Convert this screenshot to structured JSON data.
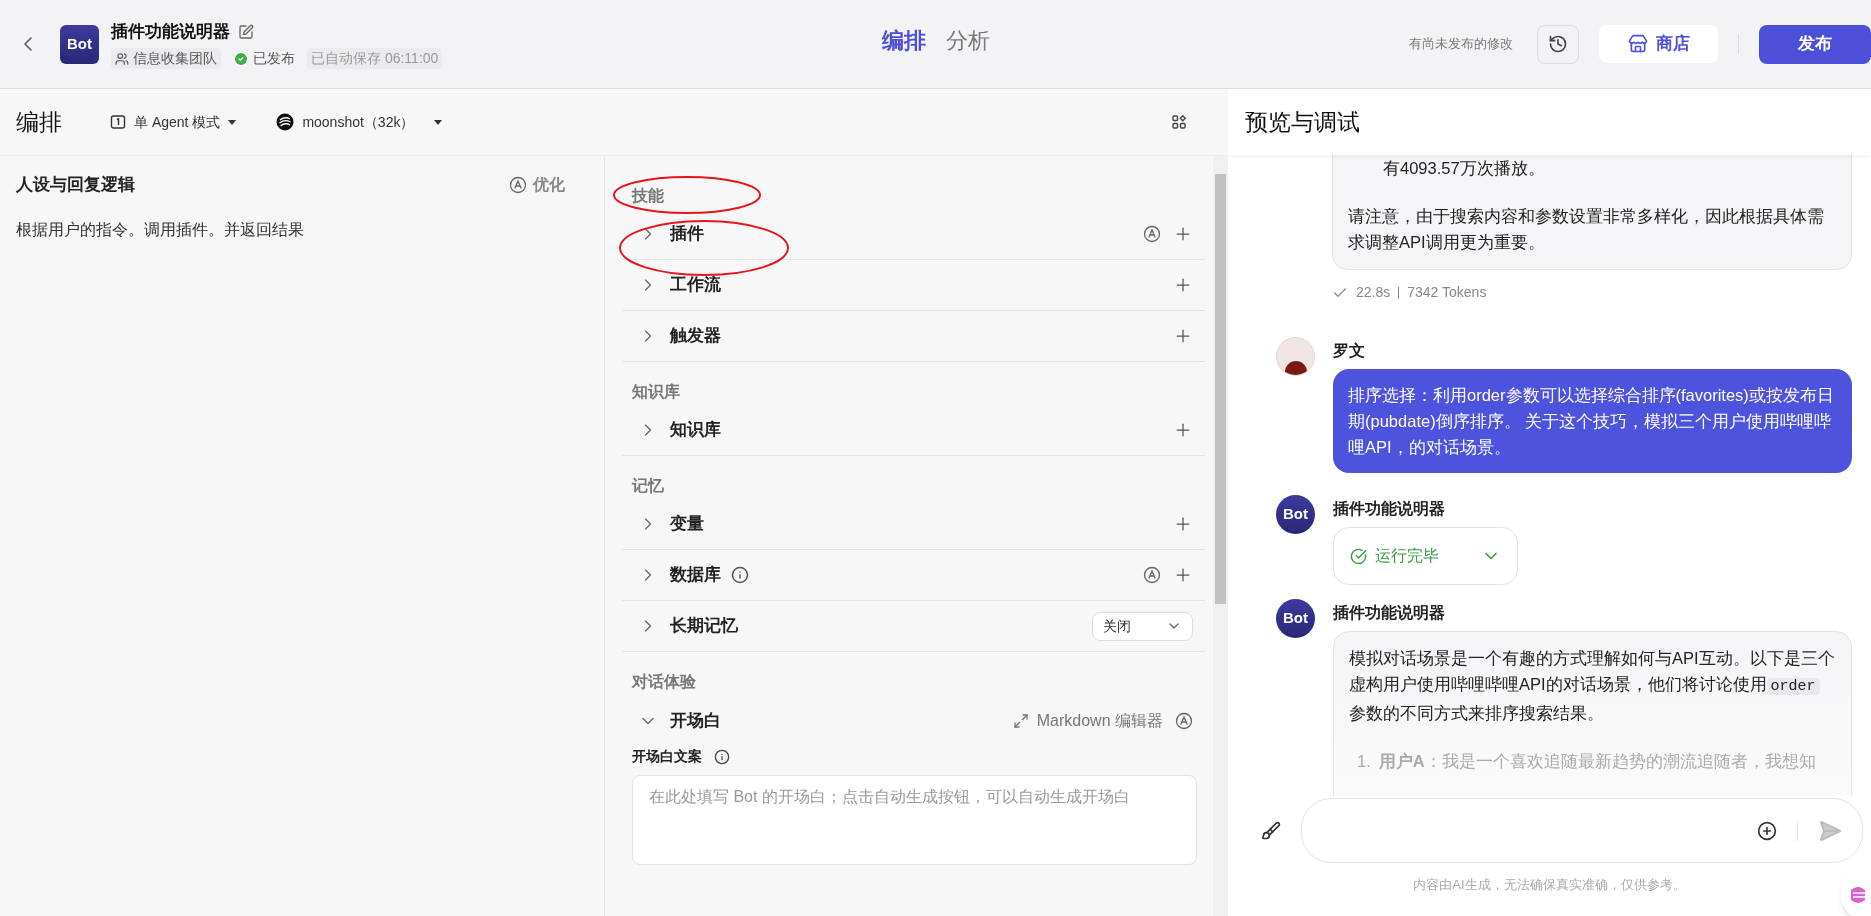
{
  "header": {
    "avatar": "Bot",
    "bot_name": "插件功能说明器",
    "team": "信息收集团队",
    "status": "已发布",
    "autosave": "已自动保存 06:11:00",
    "tabs": [
      {
        "label": "编排",
        "selected": true
      },
      {
        "label": "分析",
        "selected": false
      }
    ],
    "unpublished_note": "有尚未发布的修改",
    "store_button": "商店",
    "publish_button": "发布"
  },
  "toolbar": {
    "title": "编排",
    "mode": "单 Agent 模式",
    "model": "moonshot（32k）"
  },
  "persona": {
    "title": "人设与回复逻辑",
    "optimize": "优化",
    "text": "根据用户的指令。调用插件。并返回结果"
  },
  "sections": [
    {
      "heading": "技能",
      "items": [
        {
          "label": "插件",
          "kind": "add",
          "expanded": false,
          "auto": true,
          "info": false
        },
        {
          "label": "工作流",
          "kind": "add",
          "expanded": false,
          "auto": false,
          "info": false
        },
        {
          "label": "触发器",
          "kind": "add",
          "expanded": false,
          "auto": false,
          "info": false
        }
      ]
    },
    {
      "heading": "知识库",
      "items": [
        {
          "label": "知识库",
          "kind": "add",
          "expanded": false,
          "auto": false,
          "info": false
        }
      ]
    },
    {
      "heading": "记忆",
      "items": [
        {
          "label": "变量",
          "kind": "add",
          "expanded": false,
          "auto": false,
          "info": false
        },
        {
          "label": "数据库",
          "kind": "add",
          "expanded": false,
          "auto": true,
          "info": true
        },
        {
          "label": "长期记忆",
          "kind": "select",
          "expanded": false,
          "value": "关闭",
          "auto": false,
          "info": false
        }
      ]
    },
    {
      "heading": "对话体验",
      "items": [
        {
          "label": "开场白",
          "kind": "editor",
          "expanded": true,
          "editor": "Markdown 编辑器",
          "auto": true,
          "info": false,
          "field_label": "开场白文案",
          "placeholder": "在此处填写 Bot 的开场白；点击自动生成按钮，可以自动生成开场白"
        }
      ]
    }
  ],
  "chat": {
    "title": "预览与调试",
    "messages": [
      {
        "kind": "bot_tail",
        "bullet": "有4093.57万次播放。",
        "text": "请注意，由于搜索内容和参数设置非常多样化，因此根据具体需求调整API调用更为重要。"
      },
      {
        "kind": "meta",
        "time": "22.8s",
        "tokens": "7342 Tokens"
      },
      {
        "kind": "user",
        "name": "罗文",
        "text": "排序选择：利用order参数可以选择综合排序(favorites)或按发布日期(pubdate)倒序排序。 关于这个技巧，模拟三个用户使用哔哩哔哩API，的对话场景。"
      },
      {
        "kind": "status",
        "avatar": "Bot",
        "name": "插件功能说明器",
        "status": "运行完毕"
      },
      {
        "kind": "bot",
        "avatar": "Bot",
        "name": "插件功能说明器",
        "parts": [
          {
            "kind": "text",
            "text": "模拟对话场景是一个有趣的方式理解如何与API互动。以下是三个虚构用户使用哔哩哔哩API的对话场景，他们将讨论使用"
          },
          {
            "kind": "code",
            "text": "order"
          },
          {
            "kind": "text",
            "text": "参数的不同方式来排序搜索结果。"
          }
        ],
        "list_number": "1.",
        "list_text": "**用户A**：我是一个喜欢追随最新趋势的潮流追随者，我想知"
      }
    ],
    "disclaimer": "内容由AI生成，无法确保真实准确，仅供参考。"
  }
}
